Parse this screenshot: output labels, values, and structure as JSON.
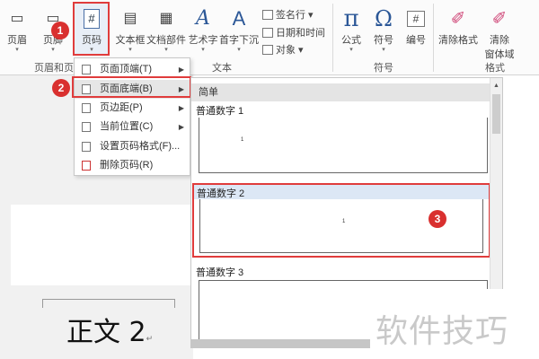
{
  "ribbon": {
    "buttons": [
      {
        "label": "页眉",
        "icon": "header-icon"
      },
      {
        "label": "页脚",
        "icon": "footer-icon"
      },
      {
        "label": "页码",
        "icon": "page-number-icon",
        "glyph": "#"
      },
      {
        "label": "文本框",
        "icon": "textbox-icon"
      },
      {
        "label": "文档部件",
        "icon": "quick-parts-icon"
      },
      {
        "label": "艺术字",
        "icon": "wordart-icon",
        "glyph": "A"
      },
      {
        "label": "首字下沉",
        "icon": "drop-cap-icon",
        "glyph": "A"
      },
      {
        "label": "公式",
        "icon": "equation-icon",
        "glyph": "π"
      },
      {
        "label": "符号",
        "icon": "symbol-icon",
        "glyph": "Ω"
      },
      {
        "label": "编号",
        "icon": "number-icon",
        "glyph": "#"
      },
      {
        "label": "清除格式",
        "icon": "clear-format-icon"
      },
      {
        "label": "清除",
        "label2": "窗体域",
        "icon": "eraser-icon"
      }
    ],
    "small_items": {
      "signature": "签名行",
      "datetime": "日期和时间",
      "object": "对象"
    },
    "groups": {
      "header_footer": "页眉和页",
      "text": "文本",
      "symbols": "符号",
      "format": "格式"
    }
  },
  "menu": {
    "items": [
      {
        "label": "页面顶端(T)",
        "submenu": true
      },
      {
        "label": "页面底端(B)",
        "submenu": true,
        "highlighted": true
      },
      {
        "label": "页边距(P)",
        "submenu": true
      },
      {
        "label": "当前位置(C)",
        "submenu": true
      },
      {
        "label": "设置页码格式(F)..."
      },
      {
        "label": "删除页码(R)"
      }
    ]
  },
  "gallery": {
    "header": "简单",
    "items": [
      {
        "title": "普通数字 1",
        "page_number": "1"
      },
      {
        "title": "普通数字 2",
        "page_number": "1",
        "selected": true
      },
      {
        "title": "普通数字 3"
      }
    ]
  },
  "document": {
    "text": "正文 2",
    "mark": "↵"
  },
  "badges": [
    "1",
    "2",
    "3"
  ],
  "watermark": "软件技巧",
  "colors": {
    "accent_red": "#e03c3c",
    "badge_red": "#d9302f",
    "selection_blue": "#dce7f5"
  }
}
